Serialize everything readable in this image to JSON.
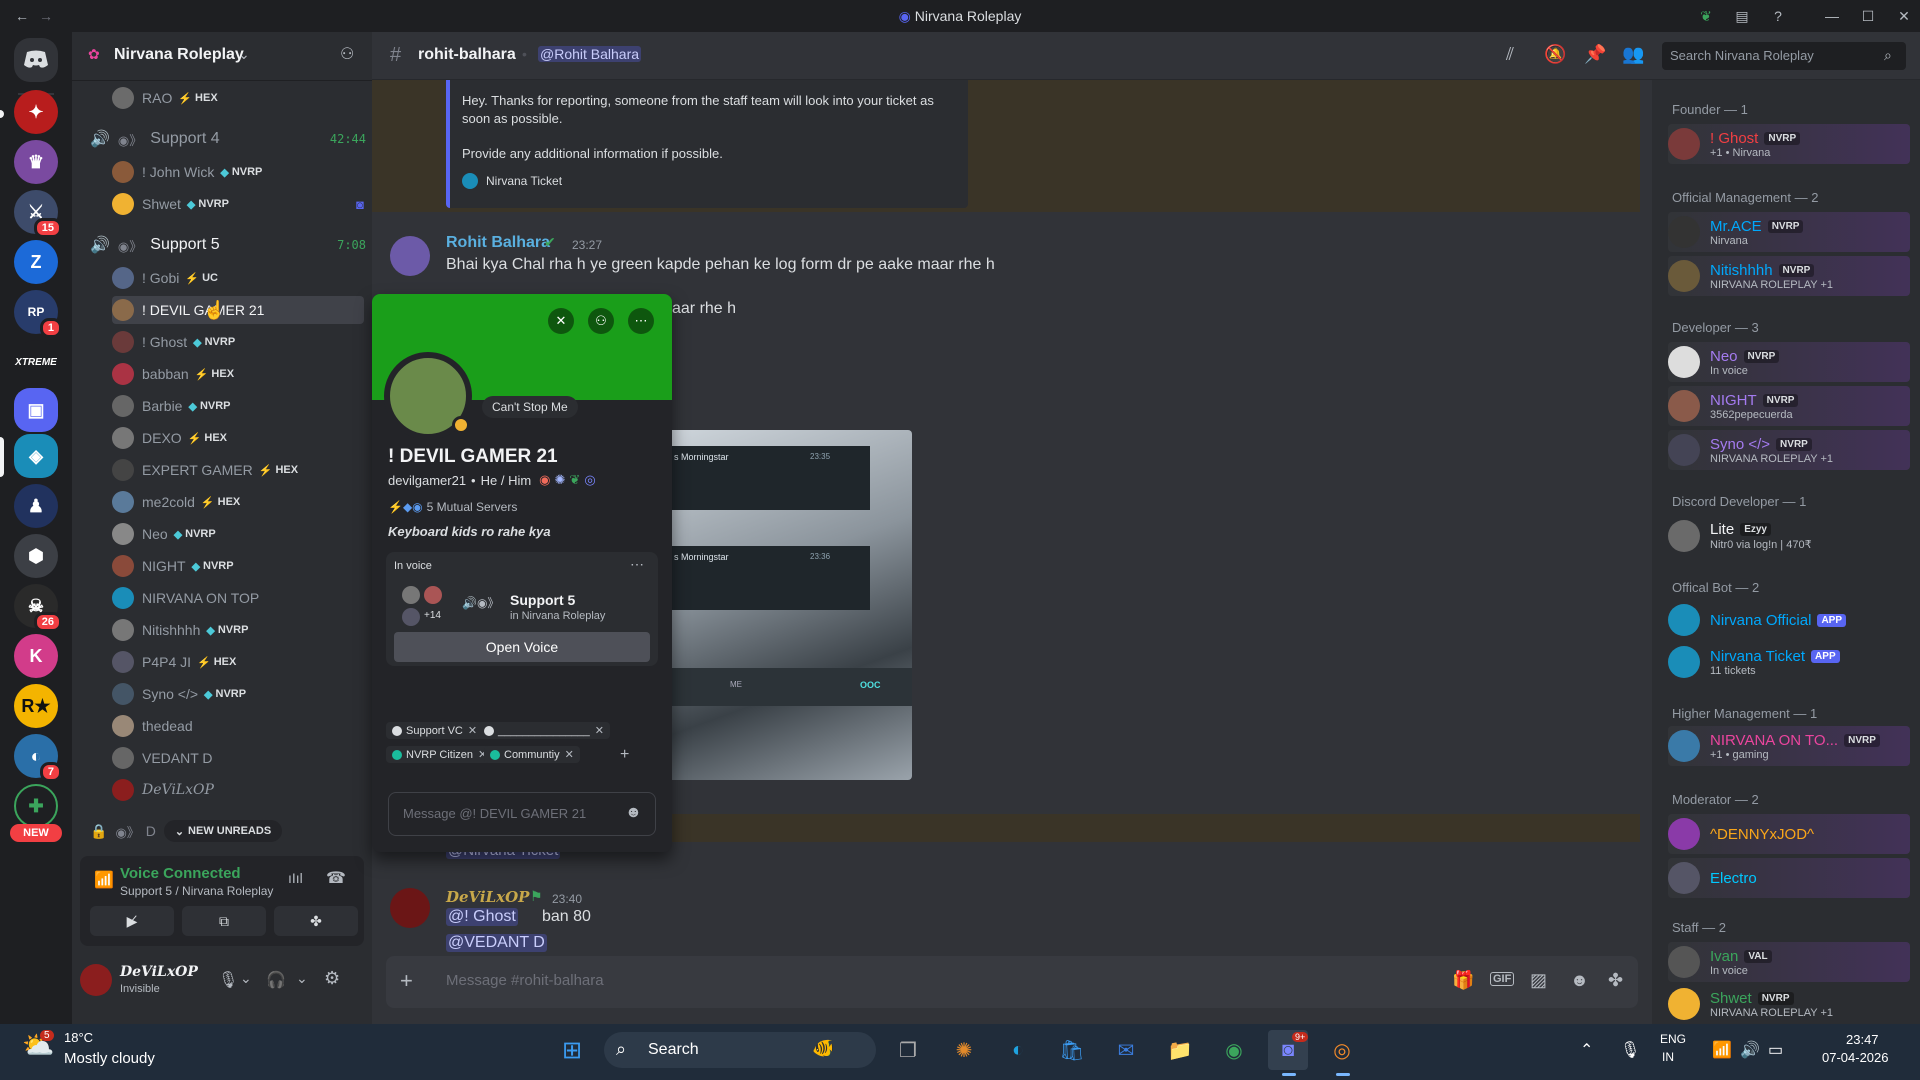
{
  "window": {
    "title": "Nirvana Roleplay"
  },
  "guild": {
    "name": "Nirvana Roleplay"
  },
  "rail": {
    "badges": [
      "15",
      "1",
      "26",
      "7"
    ],
    "new_label": "NEW",
    "xtreme": "XTREME"
  },
  "sidebar": {
    "channels": [
      {
        "name": "Support 4",
        "timer": "42:44"
      },
      {
        "name": "Support 5",
        "timer": "7:08"
      }
    ],
    "top_user": {
      "name": "RAO",
      "tag": "HEX"
    },
    "support4_users": [
      {
        "name": "! John Wick",
        "tag": "NVRP"
      },
      {
        "name": "Shwet",
        "tag": "NVRP"
      }
    ],
    "support5_users": [
      {
        "name": "! Gobi",
        "tag": "UC"
      },
      {
        "name": "! DEVIL GAMER 21",
        "tag": ""
      },
      {
        "name": "! Ghost",
        "tag": "NVRP"
      },
      {
        "name": "babban",
        "tag": "HEX"
      },
      {
        "name": "Barbie",
        "tag": "NVRP"
      },
      {
        "name": "DEXO",
        "tag": "HEX"
      },
      {
        "name": "EXPERT GAMER",
        "tag": "HEX"
      },
      {
        "name": "me2cold",
        "tag": "HEX"
      },
      {
        "name": "Neo",
        "tag": "NVRP"
      },
      {
        "name": "NIGHT",
        "tag": "NVRP"
      },
      {
        "name": "NIRVANA ON TOP",
        "tag": ""
      },
      {
        "name": "Nitishhhh",
        "tag": "NVRP"
      },
      {
        "name": "P4P4 JI",
        "tag": "HEX"
      },
      {
        "name": "Syno </>",
        "tag": "NVRP"
      },
      {
        "name": "thedead",
        "tag": ""
      },
      {
        "name": "VEDANT D",
        "tag": ""
      },
      {
        "name": "DeViLxOP",
        "tag": ""
      }
    ],
    "partial_channel": "D",
    "new_unreads": "NEW UNREADS",
    "voice": {
      "status": "Voice Connected",
      "channel": "Support 5 / Nirvana Roleplay"
    },
    "me": {
      "name": "DeViLxOP",
      "status": "Invisible"
    }
  },
  "chat_header": {
    "channel": "rohit-balhara",
    "mention": "@Rohit Balhara",
    "search_placeholder": "Search Nirvana Roleplay"
  },
  "messages": {
    "embed": {
      "line1": "Hey. Thanks for reporting, someone from the staff team will look into your ticket as soon as possible.",
      "line2": "Provide any additional information if possible.",
      "footer": "Nirvana Ticket"
    },
    "msg1": {
      "author": "Rohit Balhara",
      "time": "23:27",
      "text": "Bhai kya Chal rha h ye green kapde pehan ke log form dr pe aake maar rhe h",
      "text2": "aar rhe h"
    },
    "image_text": {
      "a1": "s Morningstar",
      "a2": "23:35",
      "b1": "s Morningstar",
      "b2": "23:36",
      "btn1": "ME",
      "btn2": "OOC"
    },
    "partial_mention": "@Nirvana Ticket",
    "msg2": {
      "author": "DeViLxOP",
      "time": "23:40",
      "mention": "@! Ghost",
      "text": "ban 80",
      "mention2": "@VEDANT D"
    },
    "composer_placeholder": "Message #rohit-balhara"
  },
  "popout": {
    "status": "Can't Stop Me",
    "display_name": "! DEVIL GAMER 21",
    "username": "devilgamer21",
    "pronouns": "He / Him",
    "mutual": "5 Mutual Servers",
    "bio": "Keyboard kids ro rahe kya",
    "in_voice_label": "In voice",
    "voice_channel": "Support 5",
    "voice_server": "in Nirvana Roleplay",
    "voice_count": "+14",
    "open_voice": "Open Voice",
    "roles": [
      "Support VC",
      "_______________",
      "NVRP Citizen",
      "Communtiy"
    ],
    "message_placeholder": "Message @! DEVIL GAMER 21"
  },
  "members": {
    "categories": [
      "Founder — 1",
      "Official Management — 2",
      "Developer — 3",
      "Discord Developer — 1",
      "Offical Bot — 2",
      "Higher Management — 1",
      "Moderator — 2",
      "Staff — 2"
    ],
    "list": [
      {
        "name": "! Ghost",
        "tag": "NVRP",
        "sub": "+1 • Nirvana",
        "color": "#f23f43"
      },
      {
        "name": "Mr.ACE",
        "tag": "NVRP",
        "sub": "Nirvana",
        "color": "#00a8fc"
      },
      {
        "name": "Nitishhhh",
        "tag": "NVRP",
        "sub": "NIRVANA ROLEPLAY +1",
        "color": "#00a8fc"
      },
      {
        "name": "Neo",
        "tag": "NVRP",
        "sub": "In voice",
        "color": "#a47bf0"
      },
      {
        "name": "NIGHT",
        "tag": "NVRP",
        "sub": "3562pepecuerda",
        "color": "#a47bf0"
      },
      {
        "name": "Syno </>",
        "tag": "NVRP",
        "sub": "NIRVANA ROLEPLAY +1",
        "color": "#a47bf0"
      },
      {
        "name": "Lite",
        "tag": "Ezyy",
        "sub": "Nitr0 via log!n | 470₹",
        "color": "#f2f3f5"
      },
      {
        "name": "Nirvana Official",
        "tag": "APP",
        "sub": "",
        "color": "#00a8fc"
      },
      {
        "name": "Nirvana Ticket",
        "tag": "APP",
        "sub": "11 tickets",
        "color": "#00a8fc"
      },
      {
        "name": "NIRVANA ON TO...",
        "tag": "NVRP",
        "sub": "+1 • gaming",
        "color": "#eb459e"
      },
      {
        "name": "^DENNYxJOD^",
        "tag": "",
        "sub": "",
        "color": "#faa61a"
      },
      {
        "name": "Electro",
        "tag": "",
        "sub": "",
        "color": "#00c8ff"
      },
      {
        "name": "Ivan",
        "tag": "VAL",
        "sub": "In voice",
        "color": "#3ba55c"
      },
      {
        "name": "Shwet",
        "tag": "NVRP",
        "sub": "NIRVANA ROLEPLAY +1",
        "color": "#3ba55c"
      }
    ]
  },
  "taskbar": {
    "weather_temp": "18°C",
    "weather_text": "Mostly cloudy",
    "weather_badge": "5",
    "search": "Search",
    "lang1": "ENG",
    "lang2": "IN",
    "time": "23:47",
    "date": "07-04-2026",
    "discord_badge": "9+"
  }
}
